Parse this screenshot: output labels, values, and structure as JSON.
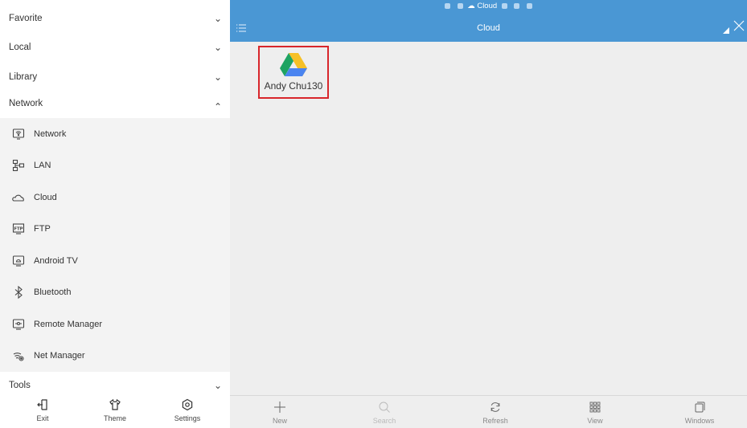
{
  "sidebar": {
    "sections": {
      "favorite": "Favorite",
      "local": "Local",
      "library": "Library",
      "network": "Network",
      "tools": "Tools"
    },
    "network_items": [
      {
        "label": "Network",
        "icon": "wifi-monitor-icon"
      },
      {
        "label": "LAN",
        "icon": "lan-icon"
      },
      {
        "label": "Cloud",
        "icon": "cloud-icon"
      },
      {
        "label": "FTP",
        "icon": "ftp-icon"
      },
      {
        "label": "Android TV",
        "icon": "android-tv-icon"
      },
      {
        "label": "Bluetooth",
        "icon": "bluetooth-icon"
      },
      {
        "label": "Remote Manager",
        "icon": "remote-manager-icon"
      },
      {
        "label": "Net Manager",
        "icon": "net-manager-icon"
      }
    ],
    "bottom": {
      "exit": "Exit",
      "theme": "Theme",
      "settings": "Settings"
    }
  },
  "main": {
    "status_text": "Cloud",
    "title": "Cloud",
    "items": [
      {
        "name": "Andy Chu130",
        "icon": "google-drive-icon"
      }
    ],
    "toolbar": {
      "new": "New",
      "search": "Search",
      "refresh": "Refresh",
      "view": "View",
      "windows": "Windows"
    }
  },
  "colors": {
    "accent": "#4a97d4",
    "selection_border": "#d8262b",
    "sublist_bg": "#f3f3f3",
    "content_bg": "#eeeeee"
  }
}
